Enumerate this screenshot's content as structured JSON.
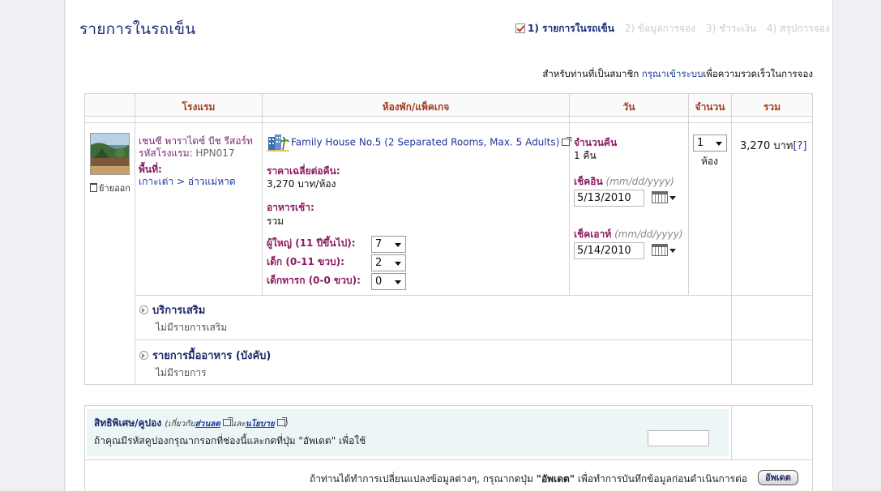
{
  "page": {
    "title": "รายการในรถเข็น",
    "steps": [
      {
        "label": "1) รายการในรถเข็น",
        "active": true
      },
      {
        "label": "2) ข้อมูลการจอง",
        "active": false
      },
      {
        "label": "3) ชำระเงิน",
        "active": false
      },
      {
        "label": "4) สรุปการจอง",
        "active": false
      }
    ],
    "member_prefix": "สำหรับท่านที่เป็นสมาชิก ",
    "member_link": "กรุณาเข้าระบบ",
    "member_suffix": "เพื่อความรวดเร็วในการจอง"
  },
  "table": {
    "headers": {
      "hotel": "โรงแรม",
      "room": "ห้องพัก/แพ็คเกจ",
      "date": "วัน",
      "qty": "จำนวน",
      "total": "รวม"
    },
    "row": {
      "remove_label": "ย้ายออก",
      "hotel_name_line1": "เชนซี พาราไดซ์ บีช รีสอร์ท",
      "hotel_code_label": "รหัสโรงแรม: ",
      "hotel_code": "HPN017",
      "area_label": "พื้นที่:",
      "area_value": "เกาะเต่า > อ่าวแม่หาด",
      "room_name": "Family House No.5 (2 Separated Rooms, Max. 5 Adults)",
      "avg_price_label": "ราคาเฉลี่ยต่อคืน:",
      "avg_price_value": "3,270 บาท/ห้อง",
      "breakfast_label": "อาหารเช้า:",
      "breakfast_value": "รวม",
      "adults_label": "ผู้ใหญ่ (11 ปีขึ้นไป):",
      "adults_value": "7",
      "children_label": "เด็ก (0-11 ขวบ):",
      "children_value": "2",
      "infants_label": "เด็กทารก (0-0 ขวบ):",
      "infants_value": "0",
      "nights_label": "จำนวนคืน",
      "nights_value": "1 คืน",
      "checkin_label": "เช็คอิน",
      "checkin_format": "(mm/dd/yyyy)",
      "checkin_value": "5/13/2010",
      "checkout_label": "เช็คเอาท์",
      "checkout_format": "(mm/dd/yyyy)",
      "checkout_value": "5/14/2010",
      "qty_value": "1",
      "qty_unit": "ห้อง",
      "total_value": "3,270 บาท",
      "total_help": "[?]"
    },
    "extras": {
      "title": "บริการเสริม",
      "empty": "ไม่มีรายการเสริม"
    },
    "meals": {
      "title": "รายการมื้ออาหาร (บังคับ)",
      "empty": "ไม่มีรายการ"
    }
  },
  "coupon": {
    "title": "สิทธิพิเศษ/คูปอง",
    "note_prefix": "(เกี่ยวกับ",
    "note_link1": "ส่วนลด",
    "note_mid": "และ",
    "note_link2": "นโยบาย",
    "note_suffix": ")",
    "instruction": "ถ้าคุณมีรหัสคูปองกรุณากรอกที่ช่องนี้และกดที่ปุ่ม \"อัพเดต\" เพื่อใช้",
    "code_value": ""
  },
  "footer": {
    "text_prefix": "ถ้าท่านได้ทำการเปลี่ยนแปลงข้อมูลต่างๆ, กรุณากดปุ่ม ",
    "text_bold": "\"อัพเดต\"",
    "text_suffix": " เพื่อทำการบันทึกข้อมูลก่อนดำเนินการต่อ",
    "update_button": "อัพเดต"
  },
  "colors": {
    "title": "#1f2f7a",
    "header": "#a23a1e",
    "label": "#8b1b62",
    "link": "#1a3a9c"
  }
}
